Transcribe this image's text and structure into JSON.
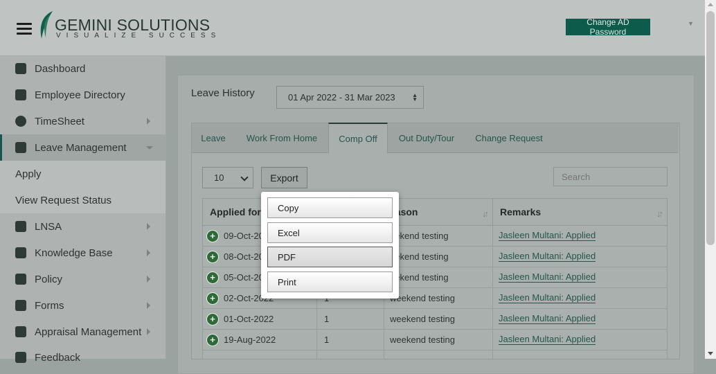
{
  "header": {
    "logo_text": "GEMINI SOLUTIONS",
    "logo_tagline": "VISUALIZE SUCCESS",
    "change_password_label": "Change AD Password",
    "menu_icon": "hamburger-icon"
  },
  "sidebar": {
    "items": [
      {
        "label": "Dashboard",
        "icon": "dashboard-icon"
      },
      {
        "label": "Employee Directory",
        "icon": "contact-card-icon"
      },
      {
        "label": "TimeSheet",
        "icon": "clock-icon"
      },
      {
        "label": "Leave Management",
        "icon": "home-icon"
      },
      {
        "label": "Apply"
      },
      {
        "label": "View Request Status"
      },
      {
        "label": "LNSA",
        "icon": "paper-plane-icon"
      },
      {
        "label": "Knowledge Base",
        "icon": "folder-icon"
      },
      {
        "label": "Policy",
        "icon": "file-icon"
      },
      {
        "label": "Forms",
        "icon": "form-icon"
      },
      {
        "label": "Appraisal Management",
        "icon": "graduation-cap-icon"
      },
      {
        "label": "Feedback",
        "icon": "feedback-icon"
      }
    ]
  },
  "main": {
    "leave_history_label": "Leave History",
    "financial_year": "01 Apr 2022 - 31 Mar 2023",
    "tabs": [
      {
        "label": "Leave"
      },
      {
        "label": "Work From Home"
      },
      {
        "label": "Comp Off",
        "active": true
      },
      {
        "label": "Out Duty/Tour"
      },
      {
        "label": "Change Request"
      }
    ],
    "page_size": "10",
    "export_label": "Export",
    "search_placeholder": "Search",
    "export_menu": [
      "Copy",
      "Excel",
      "PDF",
      "Print"
    ],
    "table": {
      "headers": [
        "Applied for",
        "",
        "eason",
        "Remarks"
      ],
      "rows": [
        {
          "applied_for": "09-Oct-20",
          "days": "",
          "reason": "eekend testing",
          "remarks": "Jasleen Multani: Applied"
        },
        {
          "applied_for": "08-Oct-20",
          "days": "",
          "reason": "eekend testing",
          "remarks": "Jasleen Multani: Applied"
        },
        {
          "applied_for": "05-Oct-20",
          "days": "",
          "reason": "eekend testing",
          "remarks": "Jasleen Multani: Applied"
        },
        {
          "applied_for": "02-Oct-2022",
          "days": "1",
          "reason": "weekend testing",
          "remarks": "Jasleen Multani: Applied"
        },
        {
          "applied_for": "01-Oct-2022",
          "days": "1",
          "reason": "weekend testing",
          "remarks": "Jasleen Multani: Applied"
        },
        {
          "applied_for": "19-Aug-2022",
          "days": "1",
          "reason": "weekend testing",
          "remarks": "Jasleen Multani: Applied"
        }
      ]
    }
  },
  "colors": {
    "brand": "#0d5b4b",
    "link": "#24564b",
    "overlay": "#9aa39f"
  }
}
